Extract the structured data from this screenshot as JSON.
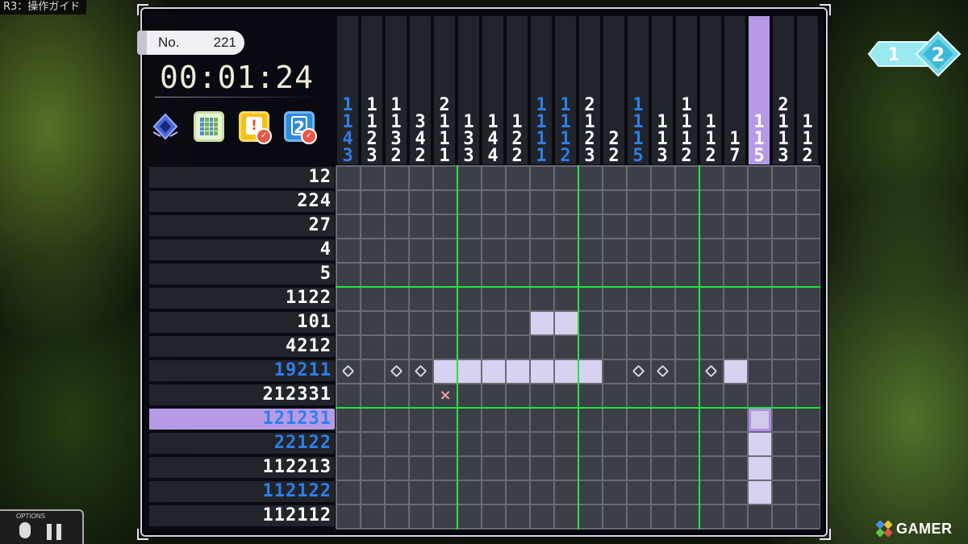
{
  "overlay": {
    "control_hint": "R3：操作ガイド"
  },
  "puzzle": {
    "number_label": "No.",
    "number_value": "221",
    "timer": "00:01:24"
  },
  "page_indicator": {
    "current": "1",
    "next": "2"
  },
  "options": {
    "label": "OPTIONS"
  },
  "watermark": {
    "text": "GAMER"
  },
  "grid": {
    "cols": 20,
    "rows": 15,
    "highlight_col": 17,
    "highlight_row": 10
  },
  "column_clues": [
    {
      "nums": [
        "1",
        "1",
        "4",
        "3"
      ],
      "color": "blue"
    },
    {
      "nums": [
        "1",
        "1",
        "2",
        "3"
      ],
      "color": "white"
    },
    {
      "nums": [
        "1",
        "1",
        "3",
        "2"
      ],
      "color": "white"
    },
    {
      "nums": [
        "3",
        "4",
        "2"
      ],
      "color": "white"
    },
    {
      "nums": [
        "2",
        "1",
        "1",
        "1"
      ],
      "color": "white"
    },
    {
      "nums": [
        "1",
        "3",
        "3"
      ],
      "color": "white"
    },
    {
      "nums": [
        "1",
        "4",
        "4"
      ],
      "color": "white"
    },
    {
      "nums": [
        "1",
        "2",
        "2"
      ],
      "color": "white"
    },
    {
      "nums": [
        "1",
        "1",
        "1",
        "1"
      ],
      "color": "blue"
    },
    {
      "nums": [
        "1",
        "1",
        "1",
        "2"
      ],
      "color": "blue"
    },
    {
      "nums": [
        "2",
        "1",
        "2",
        "3"
      ],
      "color": "white"
    },
    {
      "nums": [
        "2",
        "2"
      ],
      "color": "white"
    },
    {
      "nums": [
        "1",
        "1",
        "1",
        "5"
      ],
      "color": "blue"
    },
    {
      "nums": [
        "1",
        "1",
        "3"
      ],
      "color": "white"
    },
    {
      "nums": [
        "1",
        "1",
        "1",
        "2"
      ],
      "color": "white"
    },
    {
      "nums": [
        "1",
        "1",
        "2"
      ],
      "color": "white"
    },
    {
      "nums": [
        "1",
        "7"
      ],
      "color": "white"
    },
    {
      "nums": [
        "1",
        "1",
        "5"
      ],
      "color": "white"
    },
    {
      "nums": [
        "2",
        "1",
        "1",
        "3"
      ],
      "color": "white"
    },
    {
      "nums": [
        "1",
        "1",
        "2"
      ],
      "color": "white"
    }
  ],
  "row_clues": [
    {
      "text": "12",
      "color": "white"
    },
    {
      "text": "224",
      "color": "white"
    },
    {
      "text": "27",
      "color": "white"
    },
    {
      "text": "4",
      "color": "white"
    },
    {
      "text": "5",
      "color": "white"
    },
    {
      "text": "1122",
      "color": "white"
    },
    {
      "text": "101",
      "color": "white"
    },
    {
      "text": "4212",
      "color": "white"
    },
    {
      "text": "19211",
      "color": "blue"
    },
    {
      "text": "212331",
      "color": "white"
    },
    {
      "text": "121231",
      "color": "blue"
    },
    {
      "text": "22122",
      "color": "blue"
    },
    {
      "text": "112213",
      "color": "white"
    },
    {
      "text": "112122",
      "color": "blue"
    },
    {
      "text": "112112",
      "color": "white"
    }
  ],
  "cells": {
    "filled": [
      [
        6,
        8
      ],
      [
        6,
        9
      ],
      [
        8,
        4
      ],
      [
        8,
        5
      ],
      [
        8,
        6
      ],
      [
        8,
        7
      ],
      [
        8,
        8
      ],
      [
        8,
        9
      ],
      [
        8,
        10
      ],
      [
        8,
        16
      ],
      [
        11,
        17
      ],
      [
        12,
        17
      ],
      [
        13,
        17
      ]
    ],
    "dots": [
      [
        8,
        0
      ],
      [
        8,
        2
      ],
      [
        8,
        3
      ],
      [
        8,
        12
      ],
      [
        8,
        13
      ],
      [
        8,
        15
      ]
    ],
    "crosses": [
      [
        9,
        4
      ]
    ],
    "cross_symbol": "×",
    "cursor": [
      10,
      17
    ]
  }
}
